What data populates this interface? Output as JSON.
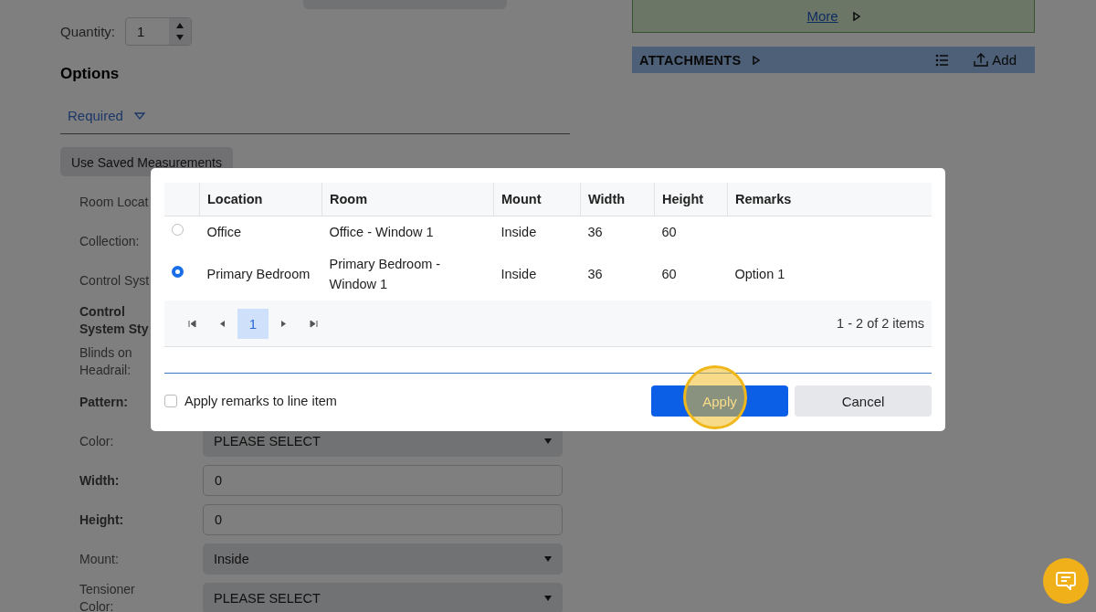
{
  "quantity": {
    "label": "Quantity:",
    "value": "1"
  },
  "options": {
    "heading": "Options",
    "filter": {
      "label": "Required"
    },
    "button": "Use Saved Measurements",
    "fields": [
      {
        "label": "Room Locat",
        "bold": false
      },
      {
        "label": "Collection:",
        "bold": false
      },
      {
        "label": "Control Syst",
        "bold": false
      },
      {
        "label": "Control System Sty",
        "bold": true
      },
      {
        "label": "Blinds on Headrail:",
        "bold": false
      },
      {
        "label": "Pattern:",
        "bold": true
      },
      {
        "label": "Color:",
        "bold": false,
        "kind": "select",
        "value": "PLEASE SELECT"
      },
      {
        "label": "Width:",
        "bold": true,
        "kind": "input",
        "value": "0"
      },
      {
        "label": "Height:",
        "bold": true,
        "kind": "input",
        "value": "0"
      },
      {
        "label": "Mount:",
        "bold": false,
        "kind": "select",
        "value": "Inside"
      },
      {
        "label": "Tensioner Color:",
        "bold": false,
        "kind": "select",
        "value": "PLEASE SELECT"
      }
    ]
  },
  "details_panel": {
    "link": "More"
  },
  "attachments": {
    "title": "ATTACHMENTS",
    "add": "Add"
  },
  "dialog": {
    "columns": [
      "Location",
      "Room",
      "Mount",
      "Width",
      "Height",
      "Remarks"
    ],
    "rows": [
      {
        "selected": false,
        "cells": [
          "Office",
          "Office - Window 1",
          "Inside",
          "36",
          "60",
          ""
        ]
      },
      {
        "selected": true,
        "cells": [
          "Primary Bedroom",
          "Primary Bedroom - Window 1",
          "Inside",
          "36",
          "60",
          "Option 1"
        ]
      }
    ],
    "pager": {
      "pages": [
        {
          "label": "1",
          "selected": true
        }
      ],
      "summary": "1 - 2 of 2 items"
    },
    "checkbox": {
      "label": "Apply remarks to line item",
      "checked": false
    },
    "buttons": [
      {
        "label": "Apply",
        "kind": "primary",
        "highlighted": true
      },
      {
        "label": "Cancel",
        "kind": "secondary",
        "highlighted": false
      }
    ]
  }
}
